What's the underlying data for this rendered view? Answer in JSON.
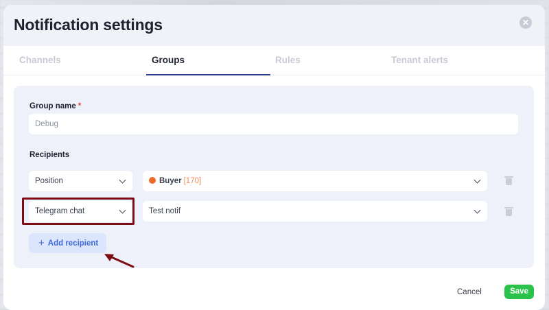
{
  "modal": {
    "title": "Notification settings",
    "close_icon": "close-icon"
  },
  "tabs": [
    {
      "label": "Channels",
      "active": false
    },
    {
      "label": "Groups",
      "active": true
    },
    {
      "label": "Rules",
      "active": false
    },
    {
      "label": "Tenant alerts",
      "active": false
    }
  ],
  "form": {
    "group_name_label": "Group name",
    "group_name_required_mark": "*",
    "group_name_value": "Debug",
    "recipients_label": "Recipients",
    "recipients": [
      {
        "type": "Position",
        "value_name": "Buyer",
        "value_count": "[170]",
        "value_dot_color": "#ef6b2b"
      },
      {
        "type": "Telegram chat",
        "value_name": "Test notif"
      }
    ],
    "add_recipient_label": "Add recipient"
  },
  "footer": {
    "cancel_label": "Cancel",
    "save_label": "Save"
  },
  "colors": {
    "accent": "#3f6ad8",
    "save": "#2bc24b",
    "highlight": "#7a0e14",
    "required": "#e2463b"
  }
}
